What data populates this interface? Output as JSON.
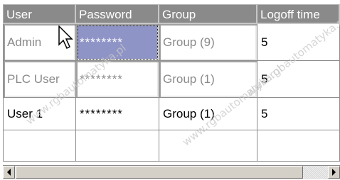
{
  "table": {
    "columns": [
      "User",
      "Password",
      "Group",
      "Logoff time"
    ],
    "rows": [
      {
        "user": "Admin",
        "password": "********",
        "group": "Group (9)",
        "logoff_time": "5"
      },
      {
        "user": "PLC User",
        "password": "********",
        "group": "Group (1)",
        "logoff_time": "5"
      },
      {
        "user": "User 1",
        "password": "********",
        "group": "Group (1)",
        "logoff_time": "5"
      },
      {
        "user": "",
        "password": "",
        "group": "",
        "logoff_time": ""
      }
    ]
  },
  "watermark": "www.rgbautomatyka.pl",
  "colors": {
    "header_bg": "#8a8a8a",
    "selected_cell": "#8f94c7",
    "disabled_text": "#8a8a8a"
  },
  "icons": {
    "cursor": "arrow-cursor-icon",
    "scroll_left": "arrow-left-icon",
    "scroll_right": "arrow-right-icon"
  }
}
